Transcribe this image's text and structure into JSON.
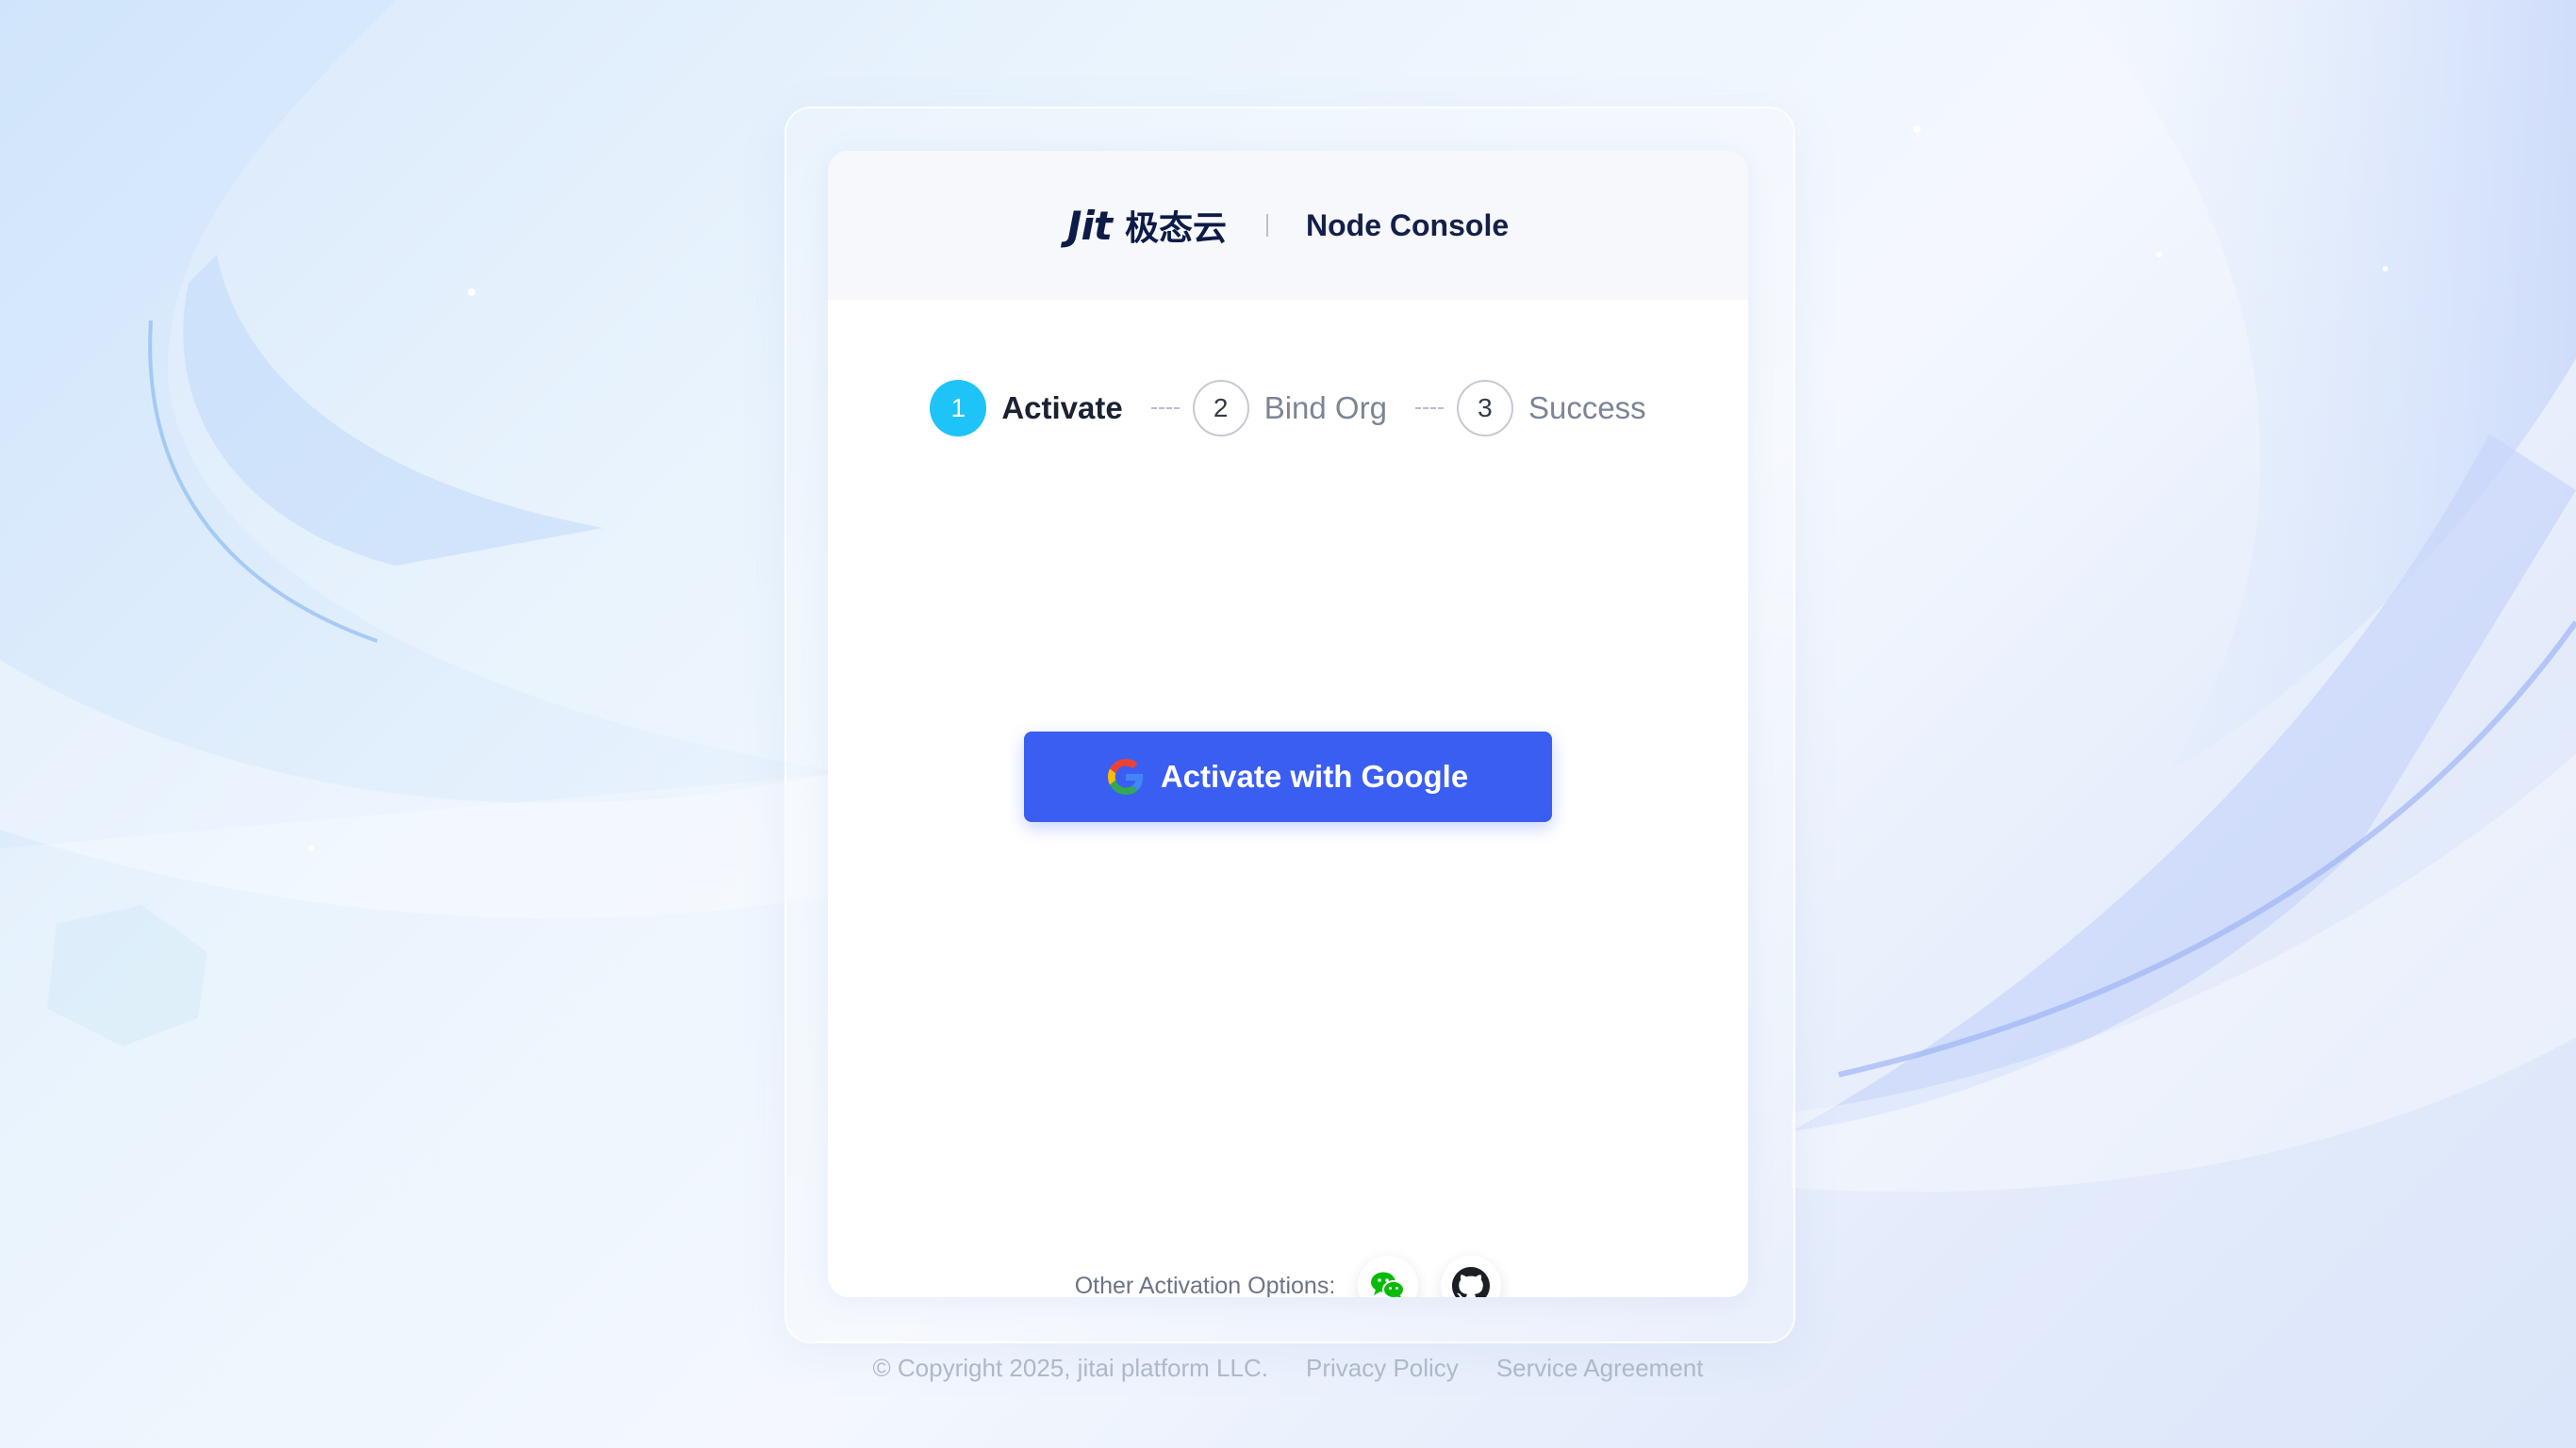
{
  "brand": {
    "logo_mark": "Jit",
    "logo_cn": "极态云",
    "console_title": "Node Console"
  },
  "steps": [
    {
      "number": "1",
      "label": "Activate",
      "state": "active"
    },
    {
      "number": "2",
      "label": "Bind Org",
      "state": "inactive"
    },
    {
      "number": "3",
      "label": "Success",
      "state": "inactive"
    }
  ],
  "primary_action": {
    "label": "Activate with Google",
    "icon": "google-icon"
  },
  "other_options": {
    "label": "Other Activation Options:",
    "items": [
      {
        "icon": "wechat-icon",
        "color": "#09bb07"
      },
      {
        "icon": "github-icon",
        "color": "#1b1f23"
      }
    ]
  },
  "footer": {
    "copyright": "© Copyright 2025, jitai platform LLC.",
    "privacy": "Privacy Policy",
    "agreement": "Service Agreement"
  },
  "colors": {
    "accent": "#3a5ef2",
    "step_active": "#1ec3f8",
    "text_dark": "#14204a"
  }
}
